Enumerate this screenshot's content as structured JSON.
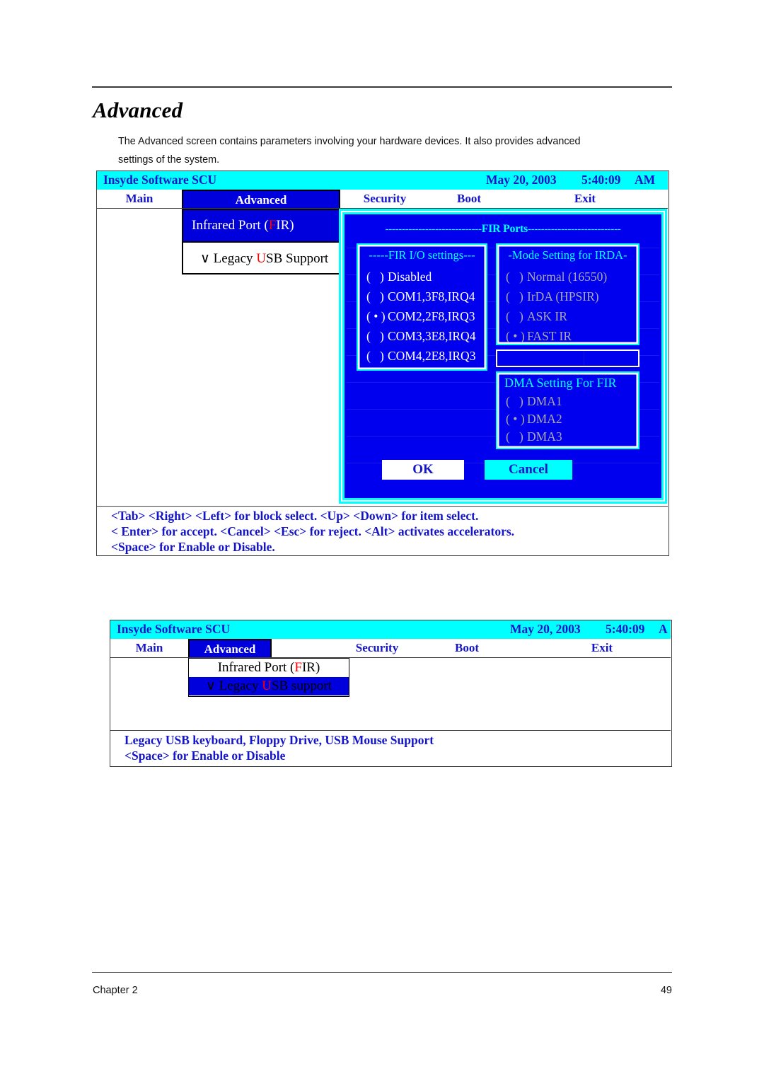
{
  "page": {
    "title": "Advanced",
    "paragraph_line1": "The Advanced screen contains parameters involving your hardware devices. It also provides advanced",
    "paragraph_line2": "settings of the system.",
    "footer_chapter": "Chapter 2",
    "footer_page": "49"
  },
  "colors": {
    "title_bar": "#00ffff",
    "accent_blue": "#1414c8",
    "panel_blue": "#0000ee",
    "selection_blue": "#0000dd",
    "cyan_border": "#00ffff",
    "accel_red": "#ff0000",
    "disabled_gray": "#a9a9a9"
  },
  "screen1": {
    "titlebar": {
      "app": "Insyde Software SCU",
      "date": "May 20, 2003",
      "time": "5:40:09",
      "ampm": "AM"
    },
    "tabs": [
      {
        "label": "Main",
        "active": false
      },
      {
        "label": "Advanced",
        "active": true
      },
      {
        "label": "Security",
        "active": false
      },
      {
        "label": "Boot",
        "active": false
      },
      {
        "label": "Exit",
        "active": false
      }
    ],
    "menu": {
      "item1_pre": "Infrared Port (",
      "item1_accel": "F",
      "item1_post": "IR)",
      "item2_pre": "∨ Legacy ",
      "item2_accel": "U",
      "item2_post": "SB Support"
    },
    "dialog": {
      "frame_label_dashes_left": "-----------------------------",
      "frame_label": "FIR Ports",
      "frame_label_dashes_right": "----------------------------",
      "io_group": {
        "title": "-----FIR I/O settings---",
        "options": [
          {
            "label": "Disabled",
            "selected": false
          },
          {
            "label": "COM1,3F8,IRQ4",
            "selected": false
          },
          {
            "label": "COM2,2F8,IRQ3",
            "selected": true
          },
          {
            "label": "COM3,3E8,IRQ4",
            "selected": false
          },
          {
            "label": "COM4,2E8,IRQ3",
            "selected": false
          }
        ]
      },
      "irda_group": {
        "title": "-Mode Setting for IRDA-",
        "disabled": true,
        "options": [
          {
            "label": "Normal (16550)",
            "selected": false
          },
          {
            "label": "IrDA (HPSIR)",
            "selected": false
          },
          {
            "label": "ASK IR",
            "selected": false
          },
          {
            "label": "FAST IR",
            "selected": true
          }
        ]
      },
      "dma_group": {
        "title": "DMA Setting For FIR",
        "disabled": true,
        "options": [
          {
            "label": "DMA1",
            "selected": false
          },
          {
            "label": "DMA2",
            "selected": true
          },
          {
            "label": "DMA3",
            "selected": false
          }
        ]
      },
      "ok_label": "OK",
      "cancel_label": "Cancel"
    },
    "help": [
      "<Tab> <Right> <Left> for block select.   <Up> <Down> for item select.",
      "< Enter> for accept. <Cancel> <Esc> for reject. <Alt> activates accelerators.",
      "<Space> for Enable or Disable."
    ]
  },
  "screen2": {
    "titlebar": {
      "app": "Insyde Software SCU",
      "date": "May 20, 2003",
      "time": "5:40:09",
      "ampm": "A"
    },
    "tabs": [
      {
        "label": "Main",
        "active": false
      },
      {
        "label": "Advanced",
        "active": true
      },
      {
        "label": "Security",
        "active": false
      },
      {
        "label": "Boot",
        "active": false
      },
      {
        "label": "Exit",
        "active": false
      }
    ],
    "menu": {
      "item1_pre": "Infrared Port (",
      "item1_accel": "F",
      "item1_post": "IR)",
      "item2_pre": "∨ Legacy ",
      "item2_accel": "U",
      "item2_post": "SB support"
    },
    "help": [
      "Legacy USB keyboard, Floppy Drive, USB Mouse Support",
      "<Space> for Enable or Disable"
    ]
  }
}
